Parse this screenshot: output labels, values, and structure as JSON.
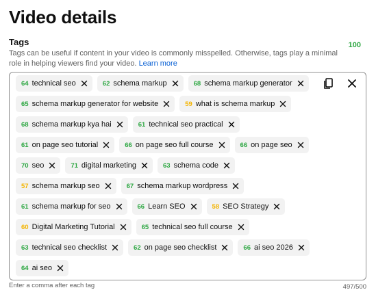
{
  "page": {
    "title": "Video details"
  },
  "tags_section": {
    "label": "Tags",
    "score": "100",
    "help": "Tags can be useful if content in your video is commonly misspelled. Otherwise, tags play a minimal role in helping viewers find your video.",
    "learn_more": "Learn more",
    "hint": "Enter a comma after each tag",
    "count": "497/500"
  },
  "colors": {
    "good": "#2ba640",
    "ok": "#f4b400",
    "link": "#065fd4"
  },
  "tag_rows": [
    [
      {
        "score": "64",
        "label": "technical seo",
        "level": "green"
      },
      {
        "score": "62",
        "label": "schema markup",
        "level": "green"
      },
      {
        "score": "68",
        "label": "schema markup generator",
        "level": "green"
      }
    ],
    [
      {
        "score": "65",
        "label": "schema markup generator for website",
        "level": "green"
      },
      {
        "score": "59",
        "label": "what is schema markup",
        "level": "yellow"
      }
    ],
    [
      {
        "score": "68",
        "label": "schema markup kya hai",
        "level": "green"
      },
      {
        "score": "61",
        "label": "technical seo practical",
        "level": "green"
      }
    ],
    [
      {
        "score": "61",
        "label": "on page seo tutorial",
        "level": "green"
      },
      {
        "score": "66",
        "label": "on page seo full course",
        "level": "green"
      },
      {
        "score": "66",
        "label": "on page seo",
        "level": "green"
      }
    ],
    [
      {
        "score": "70",
        "label": "seo",
        "level": "green"
      },
      {
        "score": "71",
        "label": "digital marketing",
        "level": "green"
      },
      {
        "score": "63",
        "label": "schema code",
        "level": "green"
      }
    ],
    [
      {
        "score": "57",
        "label": "schema markup seo",
        "level": "yellow"
      },
      {
        "score": "67",
        "label": "schema markup wordpress",
        "level": "green"
      }
    ],
    [
      {
        "score": "61",
        "label": "schema markup for seo",
        "level": "green"
      },
      {
        "score": "66",
        "label": "Learn SEO",
        "level": "green"
      },
      {
        "score": "58",
        "label": "SEO Strategy",
        "level": "yellow"
      }
    ],
    [
      {
        "score": "60",
        "label": "Digital Marketing Tutorial",
        "level": "yellow"
      },
      {
        "score": "65",
        "label": "technical seo full course",
        "level": "green"
      }
    ],
    [
      {
        "score": "63",
        "label": "technical seo checklist",
        "level": "green"
      },
      {
        "score": "62",
        "label": "on page seo checklist",
        "level": "green"
      },
      {
        "score": "66",
        "label": "ai seo 2026",
        "level": "green"
      }
    ],
    [
      {
        "score": "64",
        "label": "ai seo",
        "level": "green"
      }
    ]
  ],
  "icons": {
    "copy": "copy-icon",
    "clear": "close-icon",
    "remove": "close-icon"
  }
}
